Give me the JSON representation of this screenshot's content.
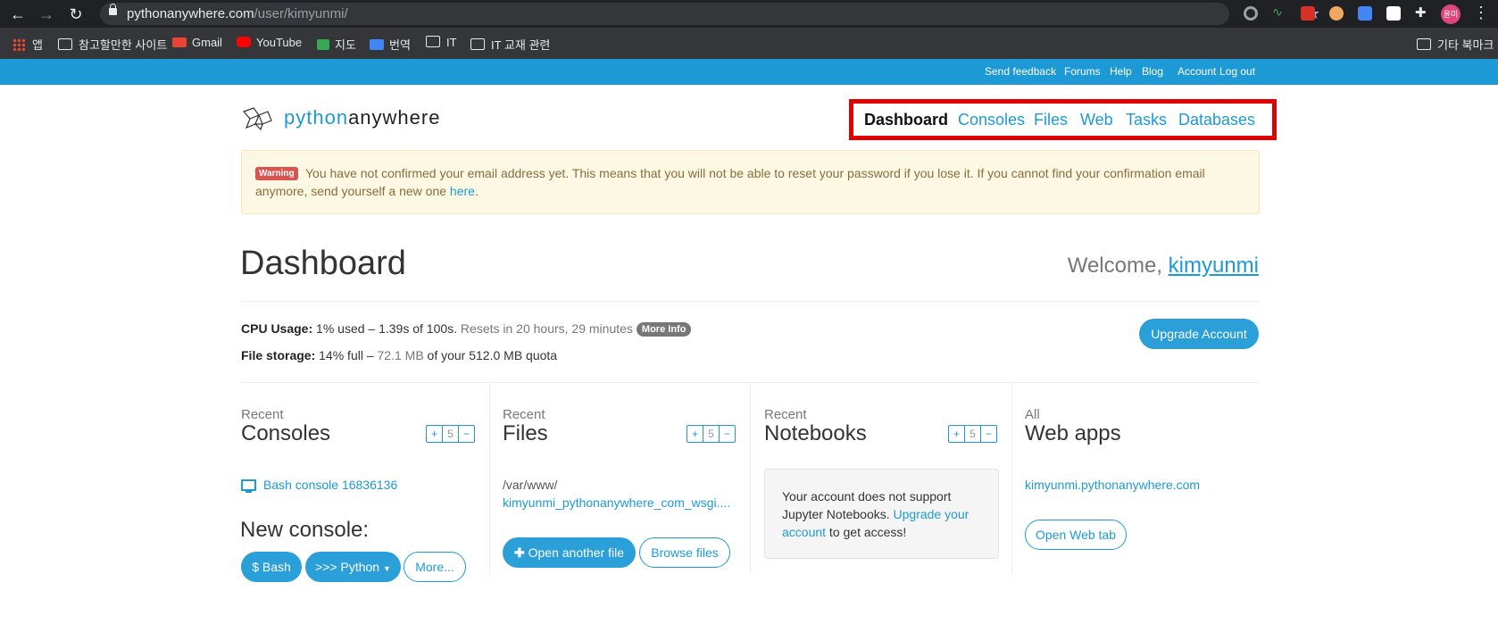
{
  "browser": {
    "url_host": "pythonanywhere.com",
    "url_path": "/user/kimyunmi/",
    "avatar_initials": "윤미",
    "bookmarks": [
      "앱",
      "참고할만한 사이트",
      "Gmail",
      "YouTube",
      "지도",
      "번역",
      "IT",
      "IT 교재 관련"
    ],
    "other_bookmarks": "기타 북마크"
  },
  "topbar": {
    "links": [
      "Send feedback",
      "Forums",
      "Help",
      "Blog",
      "Account",
      "Log out"
    ]
  },
  "header": {
    "logo_python": "python",
    "logo_anywhere": "anywhere",
    "nav": [
      "Dashboard",
      "Consoles",
      "Files",
      "Web",
      "Tasks",
      "Databases"
    ],
    "active_nav": "Dashboard",
    "highlight_color": "#e00000"
  },
  "warning": {
    "badge": "Warning",
    "text": "You have not confirmed your email address yet. This means that you will not be able to reset your password if you lose it. If you cannot find your confirmation email anymore, send yourself a new one ",
    "link": "here",
    "end": "."
  },
  "dashboard": {
    "title": "Dashboard",
    "welcome": "Welcome, ",
    "username": "kimyunmi",
    "cpu_label": "CPU Usage:",
    "cpu_value": "1% used – 1.39s of 100s.",
    "cpu_reset": "Resets in 20 hours, 29 minutes",
    "more_info": "More Info",
    "storage_label": "File storage:",
    "storage_value": "14% full –",
    "storage_used": "72.1 MB",
    "storage_quota": "of your 512.0 MB quota",
    "upgrade_button": "Upgrade Account"
  },
  "columns": {
    "consoles": {
      "sub": "Recent",
      "title": "Consoles",
      "count": "5",
      "item": "Bash console 16836136",
      "new_console": "New console:",
      "buttons": {
        "bash": "$ Bash",
        "python": ">>> Python",
        "more": "More..."
      }
    },
    "files": {
      "sub": "Recent",
      "title": "Files",
      "count": "5",
      "path_dir": "/var/www/",
      "path_file": "kimyunmi_pythonanywhere_com_wsgi....",
      "open_button": "Open another file",
      "browse_button": "Browse files"
    },
    "notebooks": {
      "sub": "Recent",
      "title": "Notebooks",
      "count": "5",
      "message_start": "Your account does not support Jupyter Notebooks. ",
      "message_link": "Upgrade your account",
      "message_end": " to get access!"
    },
    "webapps": {
      "sub": "All",
      "title": "Web apps",
      "item": "kimyunmi.pythonanywhere.com",
      "open_button": "Open Web tab"
    }
  },
  "stepper": {
    "plus": "+",
    "minus": "−"
  }
}
